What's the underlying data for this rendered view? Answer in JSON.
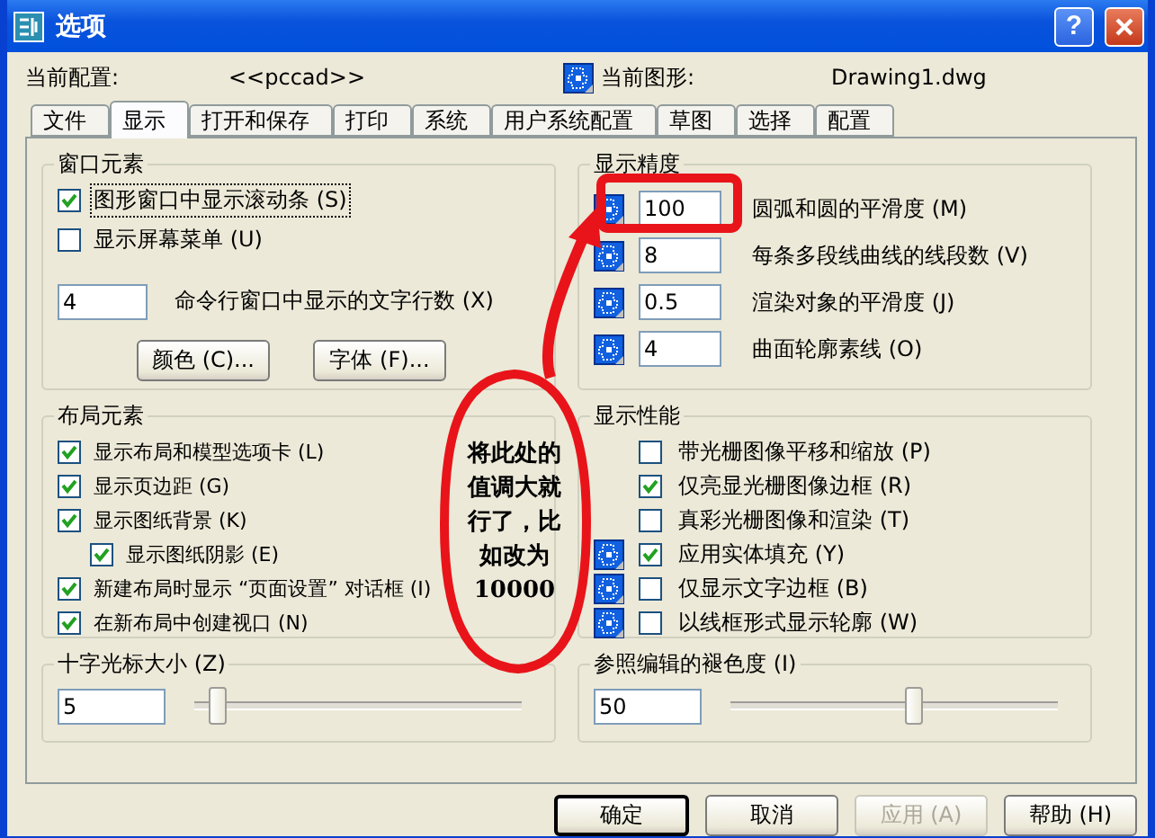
{
  "window": {
    "title": "选项",
    "help_button": "?"
  },
  "profile": {
    "label": "当前配置:",
    "value": "<<pccad>>"
  },
  "drawing": {
    "label": "当前图形:",
    "value": "Drawing1.dwg"
  },
  "tabs": [
    {
      "label": "文件",
      "selected": false
    },
    {
      "label": "显示",
      "selected": true
    },
    {
      "label": "打开和保存",
      "selected": false
    },
    {
      "label": "打印",
      "selected": false
    },
    {
      "label": "系统",
      "selected": false
    },
    {
      "label": "用户系统配置",
      "selected": false
    },
    {
      "label": "草图",
      "selected": false
    },
    {
      "label": "选择",
      "selected": false
    },
    {
      "label": "配置",
      "selected": false
    }
  ],
  "window_elements": {
    "title": "窗口元素",
    "checkboxes": [
      {
        "label": "图形窗口中显示滚动条 (S)",
        "checked": true,
        "focused": true
      },
      {
        "label": "显示屏幕菜单 (U)",
        "checked": false,
        "focused": false
      }
    ],
    "command_lines": {
      "value": "4",
      "label": "命令行窗口中显示的文字行数 (X)"
    },
    "buttons": [
      "颜色 (C)...",
      "字体 (F)..."
    ]
  },
  "layout_elements": {
    "title": "布局元素",
    "checkboxes": [
      {
        "label": "显示布局和模型选项卡 (L)",
        "checked": true
      },
      {
        "label": "显示页边距 (G)",
        "checked": true
      },
      {
        "label": "显示图纸背景 (K)",
        "checked": true,
        "children": [
          {
            "label": "显示图纸阴影 (E)",
            "checked": true
          }
        ]
      },
      {
        "label": "新建布局时显示 “页面设置” 对话框 (I)",
        "checked": true
      },
      {
        "label": "在新布局中创建视口 (N)",
        "checked": true
      }
    ]
  },
  "display_resolution": {
    "title": "显示精度",
    "rows": [
      {
        "value": "100",
        "label": "圆弧和圆的平滑度 (M)"
      },
      {
        "value": "8",
        "label": "每条多段线曲线的线段数 (V)"
      },
      {
        "value": "0.5",
        "label": "渲染对象的平滑度 (J)"
      },
      {
        "value": "4",
        "label": "曲面轮廓素线 (O)"
      }
    ]
  },
  "display_performance": {
    "title": "显示性能",
    "rows": [
      {
        "label": "带光栅图像平移和缩放 (P)",
        "checked": false,
        "drawing_icon": false
      },
      {
        "label": "仅亮显光栅图像边框 (R)",
        "checked": true,
        "drawing_icon": false
      },
      {
        "label": "真彩光栅图像和渲染 (T)",
        "checked": false,
        "drawing_icon": false
      },
      {
        "label": "应用实体填充 (Y)",
        "checked": true,
        "drawing_icon": true
      },
      {
        "label": "仅显示文字边框 (B)",
        "checked": false,
        "drawing_icon": true
      },
      {
        "label": "以线框形式显示轮廓 (W)",
        "checked": false,
        "drawing_icon": true
      }
    ]
  },
  "crosshair_size": {
    "title": "十字光标大小 (Z)",
    "value": "5",
    "level": 0.07
  },
  "xref_fading": {
    "title": "参照编辑的褪色度 (I)",
    "value": "50",
    "level": 0.56
  },
  "buttons": [
    {
      "label": "确定",
      "default": true,
      "disabled": false
    },
    {
      "label": "取消",
      "default": false,
      "disabled": false
    },
    {
      "label": "应用 (A)",
      "default": false,
      "disabled": true
    },
    {
      "label": "帮助 (H)",
      "default": false,
      "disabled": false
    }
  ],
  "annotation": {
    "lines": [
      "将此处的",
      "值调大就",
      "行了，比",
      "如改为",
      "10000"
    ]
  }
}
